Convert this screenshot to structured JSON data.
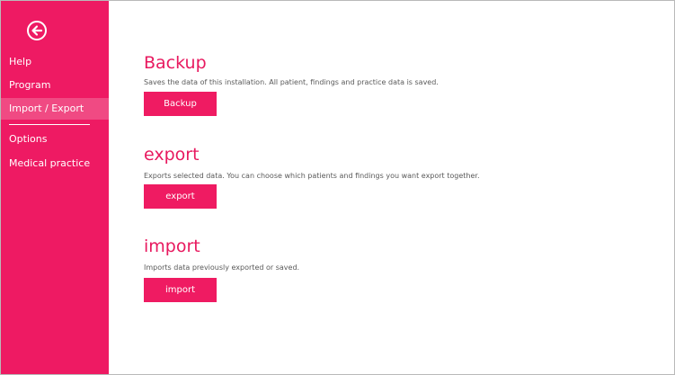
{
  "sidebar": {
    "items": [
      {
        "label": "Help"
      },
      {
        "label": "Program"
      },
      {
        "label": "Import / Export"
      },
      {
        "label": "Options"
      },
      {
        "label": "Medical practice"
      }
    ],
    "active_index": 2,
    "back_icon": "back-arrow-icon"
  },
  "sections": {
    "backup": {
      "title": "Backup",
      "description": "Saves the data of this installation. All patient, findings and practice data is saved.",
      "button_label": "Backup"
    },
    "export": {
      "title": "export",
      "description": "Exports selected data. You can choose which patients and findings you want export together.",
      "button_label": "export"
    },
    "import": {
      "title": "import",
      "description": "Imports data previously exported or saved.",
      "button_label": "import"
    }
  },
  "colors": {
    "accent": "#ee1a63",
    "active_item": "#f04a83",
    "text": "#5a5a5a"
  }
}
